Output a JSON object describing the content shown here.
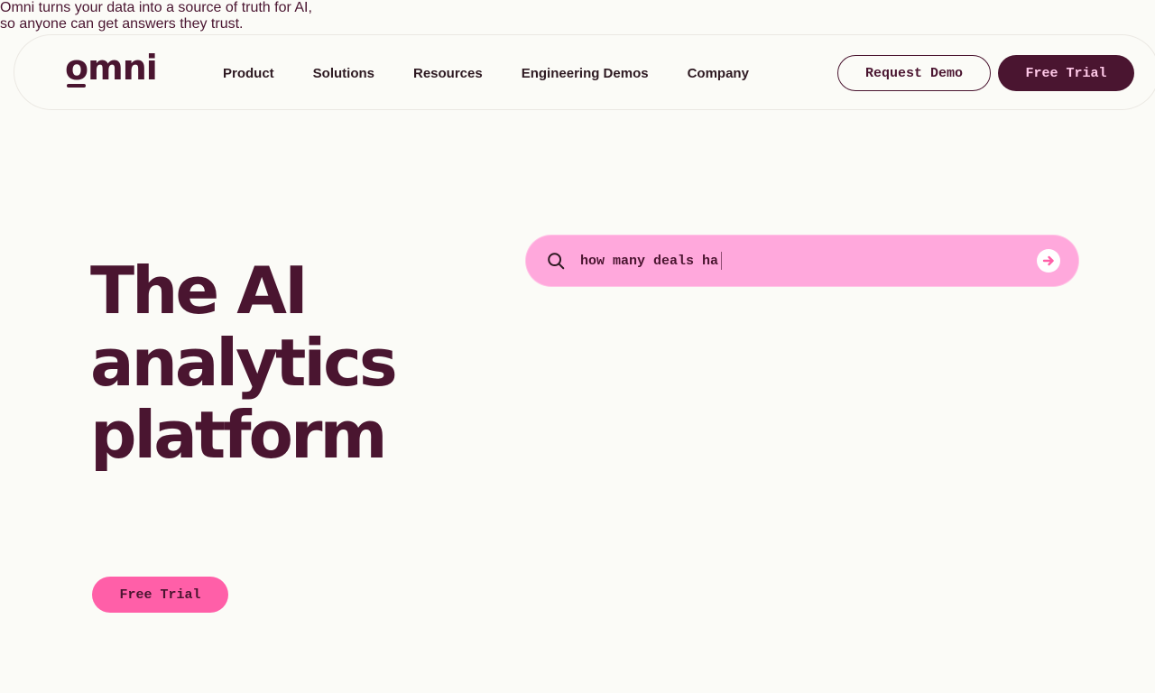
{
  "header": {
    "logo_text": "omni",
    "nav": [
      {
        "label": "Product"
      },
      {
        "label": "Solutions"
      },
      {
        "label": "Resources"
      },
      {
        "label": "Engineering Demos"
      },
      {
        "label": "Company"
      }
    ],
    "request_demo_label": "Request Demo",
    "free_trial_label": "Free Trial"
  },
  "hero": {
    "title_lines": [
      "The AI",
      "analytics",
      "platform"
    ],
    "subtitle_lines": [
      "Omni turns your data into a source of truth for AI,",
      "so anyone can get answers they trust."
    ],
    "cta_label": "Free Trial"
  },
  "search": {
    "value": "how many deals ha",
    "icon": "search-icon",
    "submit_icon": "arrow-right-icon"
  },
  "colors": {
    "brand_dark": "#4a1530",
    "brand_pink": "#ff5fa8",
    "search_bg": "#ffa8dc",
    "page_bg": "#fbfbf7"
  }
}
